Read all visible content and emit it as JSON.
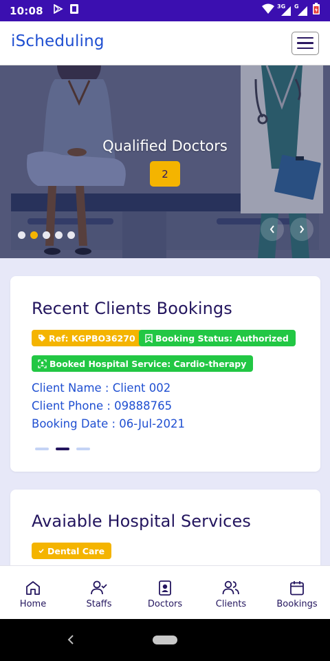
{
  "status_bar": {
    "time": "10:08",
    "network_3g": "3G",
    "network_g": "G"
  },
  "app_bar": {
    "brand": "iScheduling"
  },
  "hero": {
    "caption": "Qualified Doctors",
    "badge": "2",
    "slide_count": 5,
    "active_slide": 1
  },
  "recent_bookings": {
    "title": "Recent Clients Bookings",
    "ref_badge": "Ref: KGPBO36270",
    "status_badge": "Booking Status: Authorized",
    "service_badge": "Booked Hospital Service: Cardio-therapy",
    "client_name": "Client Name : Client 002",
    "client_phone": "Client Phone : 09888765",
    "booking_date": "Booking Date : 06-Jul-2021",
    "indicator_count": 3,
    "active_indicator": 1
  },
  "services": {
    "title": "Avaiable Hospital Services",
    "first_badge": "Dental Care"
  },
  "bottom_nav": {
    "home": "Home",
    "staffs": "Staffs",
    "doctors": "Doctors",
    "clients": "Clients",
    "bookings": "Bookings"
  },
  "colors": {
    "status_bar": "#3b0fb0",
    "brand": "#1f4fd1",
    "navy": "#23155e",
    "yellow_badge": "#f4b400",
    "green_badge": "#22c744",
    "page_bg": "#e7e8f8"
  }
}
